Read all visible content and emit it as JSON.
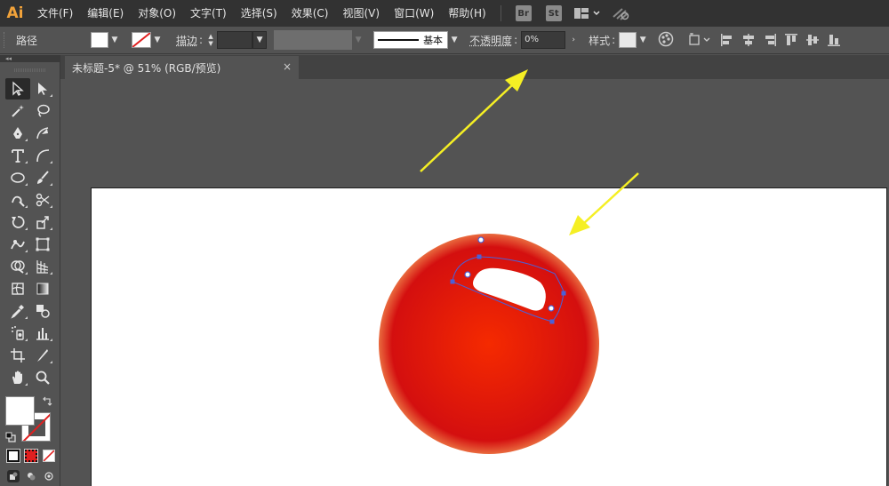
{
  "app": {
    "logo": "Ai"
  },
  "menu": [
    "文件(F)",
    "编辑(E)",
    "对象(O)",
    "文字(T)",
    "选择(S)",
    "效果(C)",
    "视图(V)",
    "窗口(W)",
    "帮助(H)"
  ],
  "badges": {
    "bridge": "Br",
    "stock": "St"
  },
  "control": {
    "object_type": "路径",
    "stroke_label": "描边",
    "stroke_profile": "基本",
    "opacity_label": "不透明度",
    "opacity_value": "0%",
    "style_label": "样式"
  },
  "document": {
    "tab_title": "未标题-5* @ 51% (RGB/预览)",
    "close_glyph": "×"
  },
  "toolbar_header": "◂◂",
  "colors": {
    "ball_center": "#f52a00",
    "ball_mid": "#d40f0f",
    "ball_rim": "#e96a3e",
    "anchor": "#4a60d8",
    "arrow": "#f5ef24",
    "logo": "#f2a33a"
  },
  "icons": [
    "selection-icon",
    "direct-selection-icon",
    "magic-wand-icon",
    "lasso-icon",
    "pen-icon",
    "curvature-icon",
    "type-icon",
    "arc-icon",
    "ellipse-icon",
    "paintbrush-icon",
    "shaper-icon",
    "scissors-icon",
    "rotate-icon",
    "scale-icon",
    "warp-icon",
    "free-transform-icon",
    "shape-builder-icon",
    "perspective-grid-icon",
    "mesh-icon",
    "gradient-icon",
    "eyedropper-icon",
    "blend-icon",
    "symbol-sprayer-icon",
    "column-graph-icon",
    "artboard-icon",
    "slice-icon",
    "hand-icon",
    "zoom-icon"
  ]
}
